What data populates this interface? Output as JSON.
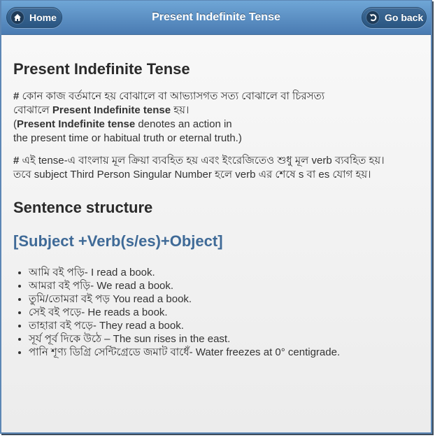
{
  "header": {
    "title": "Present Indefinite Tense",
    "home_label": "Home",
    "back_label": "Go back"
  },
  "content": {
    "heading": "Present Indefinite Tense",
    "para1": {
      "hash": "#",
      "bn_line": " কোন কাজ বর্তমানে হয় বোঝালে বা আভ্যাসগত সত্য বোঝালে বা চিরসত্য",
      "bn_line2_pre": "বোঝালে ",
      "bold_term": "Present Indefinite tense",
      "bn_line2_post": " হয়।",
      "open_paren": "(",
      "bold_term2": "Present Indefinite tense",
      "en_line1": " denotes an action in",
      "en_line2": "the present time or habitual truth or eternal truth.)"
    },
    "para2": {
      "hash": "#",
      "line1": " এই tense-এ বাংলায় মূল ক্রিয়া ব্যবহিত হয় এবং ইংরেজিতেও শুধু মূল verb ব্যবহিত হয়।",
      "line2": "তবে subject Third Person Singular Number হলে verb এর শেষে s বা es যোগ হয়।"
    },
    "structure_heading": "Sentence structure",
    "formula": "[Subject +Verb(s/es)+Object]",
    "examples": [
      "আমি বই পড়ি- I read a book.",
      "আমরা বই পড়ি- We read a book.",
      "তুমি/তোমরা বই পড় You read a book.",
      "সেই বই পড়ে- He reads a book.",
      "তাহারা বই পড়ে- They read a book.",
      "সূর্য পূর্ব দিকে উঠে – The sun rises in the east.",
      "পানি শূণ্য ডিগ্রি সেন্টিগ্রেডে জমাট বাধেঁ- Water freezes at 0° centigrade."
    ]
  },
  "icons": {
    "home": "home-icon",
    "back": "back-arrow-icon"
  },
  "colors": {
    "header_top": "#6fa6d6",
    "header_bottom": "#4a7bb2",
    "formula": "#3f6a97",
    "text": "#333333"
  }
}
